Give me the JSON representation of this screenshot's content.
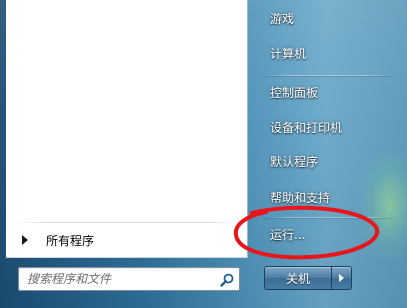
{
  "left_pane": {
    "all_programs_label": "所有程序",
    "search": {
      "placeholder": "搜索程序和文件"
    }
  },
  "right_pane": {
    "items": [
      {
        "label": "游戏"
      },
      {
        "label": "计算机"
      },
      {
        "label": "控制面板"
      },
      {
        "label": "设备和打印机"
      },
      {
        "label": "默认程序"
      },
      {
        "label": "帮助和支持"
      },
      {
        "label": "运行..."
      }
    ],
    "shutdown_label": "关机"
  },
  "annotation": {
    "color": "#e8161b",
    "target": "运行..."
  },
  "colors": {
    "accent": "#2e6f9a",
    "left_pane_bg": "#ffffff",
    "item_text": "#ffffff"
  },
  "icons": {
    "search": "search-icon",
    "all_programs_arrow": "triangle-right-icon",
    "shutdown_options": "triangle-right-icon"
  }
}
